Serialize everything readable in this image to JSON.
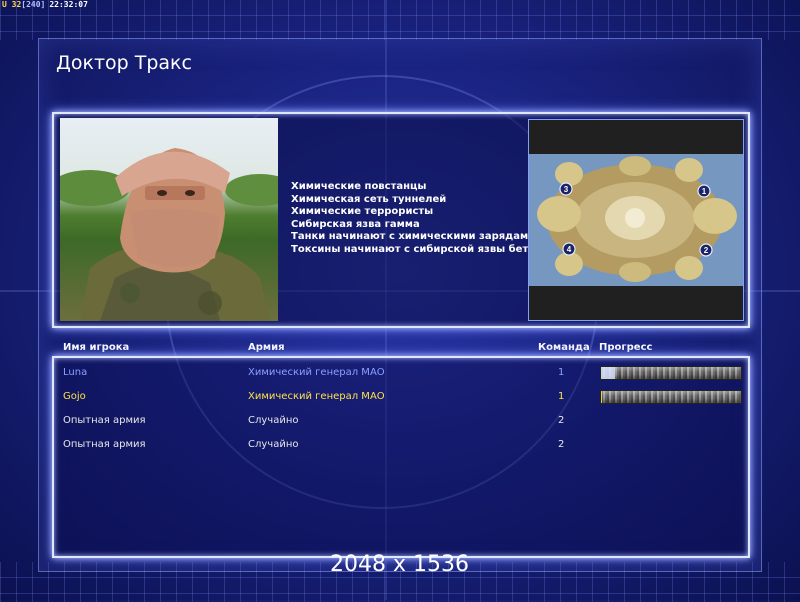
{
  "hud": {
    "prefix": "U 32",
    "ping": "[240]",
    "time": "22:32:07"
  },
  "title": "Доктор Тракс",
  "description_lines": [
    "Химические повстанцы",
    "Химическая сеть туннелей",
    "Химические террористы",
    "Сибирская язва гамма",
    "Танки начинают с химическими зарядами",
    "Токсины начинают с сибирской язвы бета"
  ],
  "map": {
    "spawn_labels": [
      "3",
      "1",
      "4",
      "2"
    ]
  },
  "table": {
    "headers": {
      "player": "Имя игрока",
      "army": "Армия",
      "team": "Команда",
      "progress": "Прогресс"
    },
    "rows": [
      {
        "player": "Luna",
        "army": "Химический генерал МАО",
        "team": "1",
        "color": "#8aa0ff",
        "progress": 0.1
      },
      {
        "player": "Gojo",
        "army": "Химический генерал МАО",
        "team": "1",
        "color": "#ffe24a",
        "progress": 0.01
      },
      {
        "player": "Опытная армия",
        "army": "Случайно",
        "team": "2",
        "color": "#e8e8e8"
      },
      {
        "player": "Опытная армия",
        "army": "Случайно",
        "team": "2",
        "color": "#e8e8e8"
      }
    ]
  },
  "resolution_label": "2048 x 1536"
}
